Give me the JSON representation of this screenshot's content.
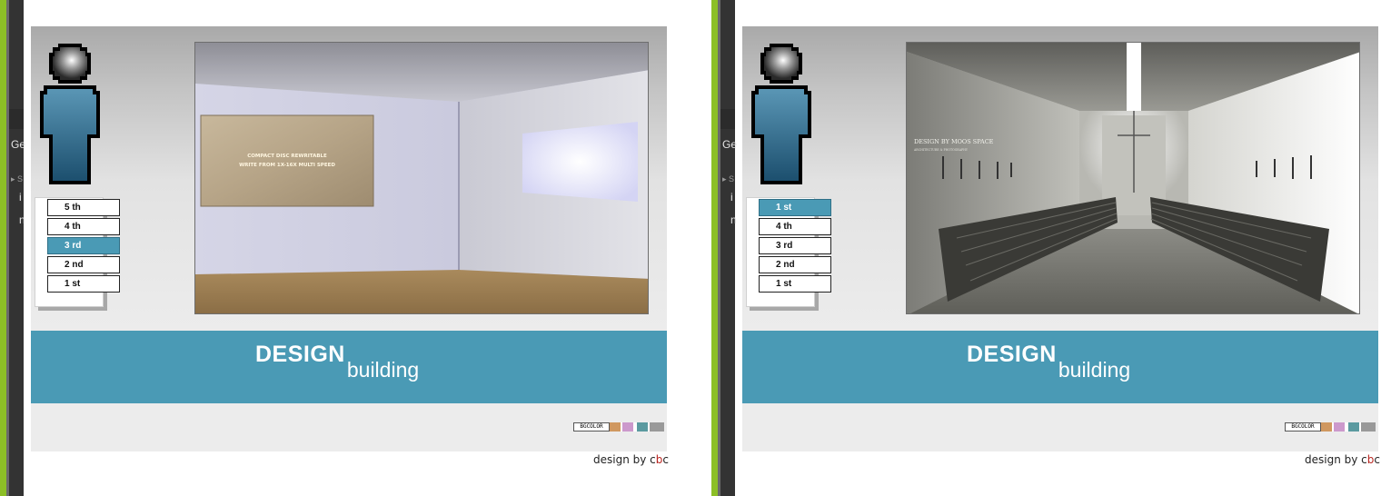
{
  "page": {
    "side_fragments": [
      "Ge",
      "▸ S",
      "i",
      "n"
    ]
  },
  "left_view": {
    "floors": [
      {
        "label": "5 th",
        "active": false
      },
      {
        "label": "4 th",
        "active": false
      },
      {
        "label": "3 rd",
        "active": true
      },
      {
        "label": "2 nd",
        "active": false
      },
      {
        "label": "1 st",
        "active": false
      }
    ],
    "photo_text": [
      "COMPACT DISC REWRITABLE",
      "WRITE FROM 1X-16X MULTI SPEED"
    ]
  },
  "right_view": {
    "floors": [
      {
        "label": "1 st",
        "active": true
      },
      {
        "label": "4 th",
        "active": false
      },
      {
        "label": "3 rd",
        "active": false
      },
      {
        "label": "2 nd",
        "active": false
      },
      {
        "label": "1 st",
        "active": false
      }
    ],
    "photo_text": [
      "DESIGN BY MOOS SPACE",
      "ARCHITECTURE & PHOTOGRAPHY"
    ]
  },
  "banner": {
    "word1": "DESIGN",
    "word2": "building"
  },
  "bgcolor": {
    "label": "BGCOLOR",
    "swatches": [
      "#d09860",
      "#ffffff",
      "#cc99cc",
      "#ffffff",
      "#5b9aa0",
      "#ffffff",
      "#999999"
    ]
  },
  "credit": {
    "prefix": "design by ",
    "c1": "c",
    "b": "b",
    "c2": "c"
  },
  "colors": {
    "accent": "#4a9ab5",
    "green": "#8cbf26",
    "credit_red": "#b8231e"
  }
}
